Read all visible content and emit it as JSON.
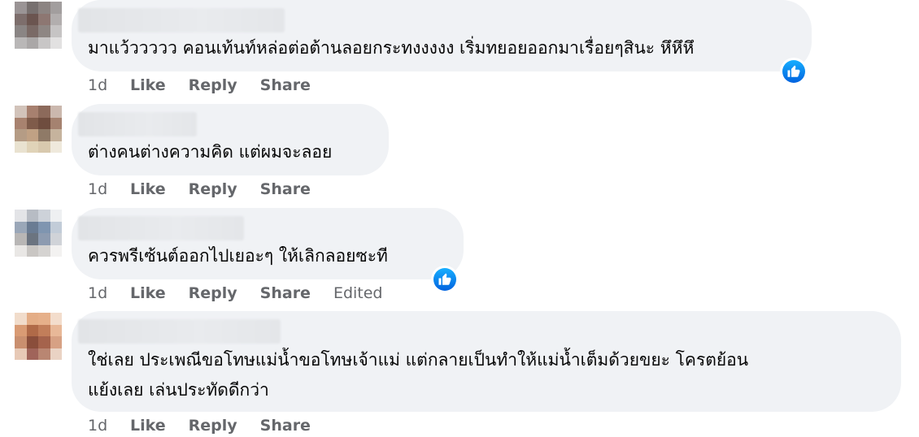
{
  "comments": [
    {
      "text_lines": [
        "มาแว้ววววว คอนเท้นท์หล่อต่อต้านลอยกระทงงงงง เริ่มทยอยออกมาเรื่อยๆสินะ หึหึหึ"
      ],
      "time": "1d",
      "like_label": "Like",
      "reply_label": "Reply",
      "share_label": "Share",
      "has_reaction": true,
      "avatar_colors": [
        "#9a9495",
        "#77706f",
        "#8c8482",
        "#a29e9e",
        "#7d6e6c",
        "#6b5550",
        "#8d7772",
        "#b2aeae",
        "#8a8584",
        "#7a6a66",
        "#8e8683",
        "#c6c4c4",
        "#b9b7b7",
        "#aaa7a7",
        "#c8c6c6",
        "#e2e1e1"
      ]
    },
    {
      "text_lines": [
        "ต่างคนต่างความคิด แต่ผมจะลอย"
      ],
      "time": "1d",
      "like_label": "Like",
      "reply_label": "Reply",
      "share_label": "Share",
      "has_reaction": false,
      "avatar_colors": [
        "#d2c3ba",
        "#a7806f",
        "#8c6a5b",
        "#cbb8ae",
        "#a8826f",
        "#7f5b4a",
        "#6f4d3f",
        "#a58270",
        "#b59c85",
        "#c0a184",
        "#8f7a67",
        "#c6b39d",
        "#e9e2d0",
        "#e0d3b8",
        "#d8c9ae",
        "#efe9dc"
      ]
    },
    {
      "text_lines": [
        "ควรพรีเซ้นต์ออกไปเยอะๆ ให้เลิกลอยซะที"
      ],
      "time": "1d",
      "like_label": "Like",
      "reply_label": "Reply",
      "share_label": "Share",
      "edited_label": "Edited",
      "has_reaction": true,
      "avatar_colors": [
        "#e3e4e7",
        "#b7bcc4",
        "#cdd2d9",
        "#eef0f2",
        "#9aa7b8",
        "#6a7c93",
        "#7f95b0",
        "#c2ccd8",
        "#b8b6b5",
        "#6b7480",
        "#8d9bb0",
        "#d0d3d8",
        "#e9e7e5",
        "#c9c6c3",
        "#d5d3d1",
        "#f3f2f1"
      ]
    },
    {
      "text_lines": [
        "ใช่เลย ประเพณีขอโทษแม่น้ำขอโทษเจ้าแม่ แต่กลายเป็นทำให้แม่น้ำเต็มด้วยขยะ โครตย้อน",
        "แย้งเลย เล่นประทัดดีกว่า"
      ],
      "time": "1d",
      "like_label": "Like",
      "reply_label": "Reply",
      "share_label": "Share",
      "has_reaction": false,
      "avatar_colors": [
        "#f1dccb",
        "#e4ad86",
        "#e6b08a",
        "#f3ddcc",
        "#d99b74",
        "#b06a48",
        "#c27e5a",
        "#e8b898",
        "#c98f6f",
        "#8a4e3b",
        "#a5634c",
        "#d7a184",
        "#e7c9b6",
        "#a0645a",
        "#b98672",
        "#ead3c4"
      ]
    }
  ]
}
